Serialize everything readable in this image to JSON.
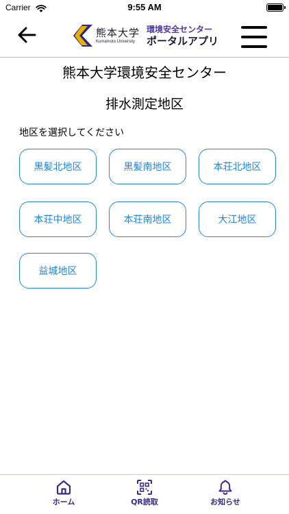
{
  "status_bar": {
    "carrier": "Carrier",
    "time": "9:55 AM"
  },
  "header": {
    "logo_university": "熊本大学",
    "logo_university_roman": "Kumamoto University",
    "logo_app_top": "環境安全センター",
    "logo_app_bottom": "ポータルアプリ"
  },
  "page": {
    "title": "熊本大学環境安全センター",
    "subtitle": "排水測定地区",
    "prompt": "地区を選択してください"
  },
  "districts": [
    "黒髪北地区",
    "黒髪南地区",
    "本荘北地区",
    "本荘中地区",
    "本荘南地区",
    "大江地区",
    "益城地区"
  ],
  "tabs": [
    {
      "label": "ホーム",
      "icon": "home-icon"
    },
    {
      "label": "QR読取",
      "icon": "qr-scan-icon"
    },
    {
      "label": "お知らせ",
      "icon": "bell-icon"
    }
  ],
  "colors": {
    "accent": "#1f86e0",
    "brand": "#3a2a86",
    "logo_gold": "#e8b000"
  }
}
